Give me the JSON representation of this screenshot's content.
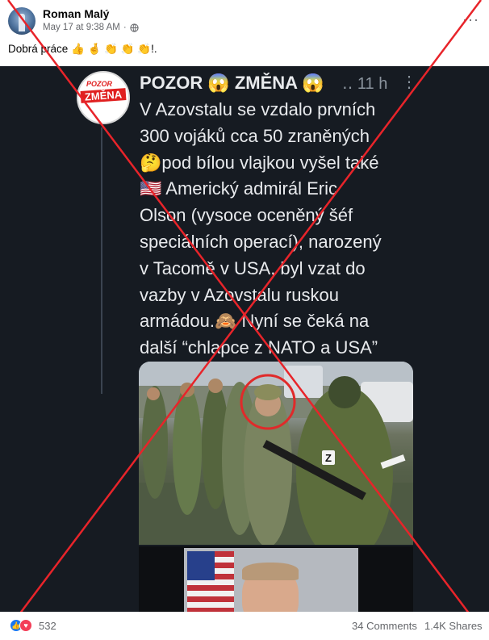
{
  "post": {
    "author": "Roman Malý",
    "timestamp": "May 17 at 9:38 AM",
    "privacy_icon": "globe-icon",
    "text": "Dobrá práce 👍 🤞 👏 👏 👏!."
  },
  "tweet": {
    "account_name": "POZOR 😱 ZMĚNA 😱",
    "handle_time": "‥ 11 h",
    "menu_glyph": "⋮",
    "avatar_text_top": "POZOR",
    "avatar_text_main": "ZMĚNA",
    "body_lines": [
      "V Azovstalu se vzdalo prvních",
      "300 vojáků cca 50 zraněných",
      "🤔pod bílou vlajkou vyšel také",
      "🇺🇸 Americký admirál Eric",
      "Olson (vysoce oceněný šéf",
      "speciálních operací), narozený",
      "v Tacomě v USA, byl vzat do",
      "vazby v Azovstalu ruskou",
      "armádou.🙈 Nyní se čeká na",
      "další “chlapce z NATO a USA”"
    ],
    "photo_badge": "Z"
  },
  "reactions": {
    "count": "532",
    "icons": [
      "like-icon",
      "love-icon"
    ],
    "comments": "34 Comments",
    "shares": "1.4K Shares"
  },
  "colors": {
    "cross": "#e8242a",
    "circle": "#e02a2a",
    "tweet_bg": "#161b22",
    "fb_like": "#1877f2",
    "fb_love": "#f33e58"
  }
}
